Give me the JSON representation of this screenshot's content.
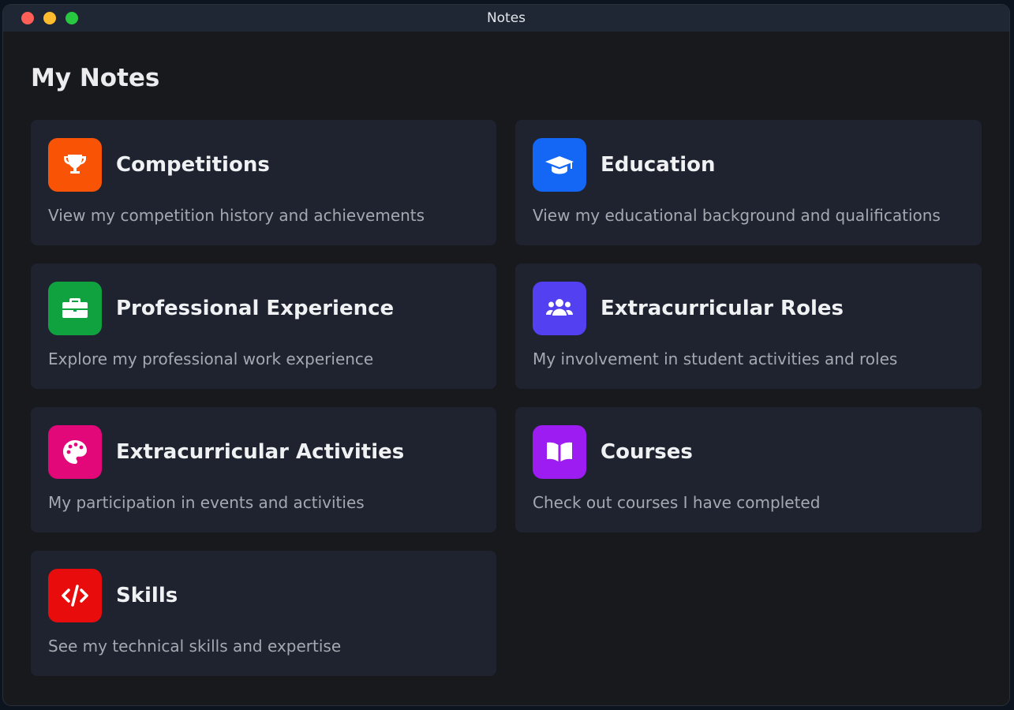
{
  "window": {
    "title": "Notes"
  },
  "page": {
    "title": "My Notes"
  },
  "cards": [
    {
      "title": "Competitions",
      "desc": "View my competition history and achievements",
      "icon": "trophy-icon",
      "color": "#f95406"
    },
    {
      "title": "Education",
      "desc": "View my educational background and qualifications",
      "icon": "graduation-cap-icon",
      "color": "#1466f5"
    },
    {
      "title": "Professional Experience",
      "desc": "Explore my professional work experience",
      "icon": "briefcase-icon",
      "color": "#10a23f"
    },
    {
      "title": "Extracurricular Roles",
      "desc": "My involvement in student activities and roles",
      "icon": "users-icon",
      "color": "#5340f0"
    },
    {
      "title": "Extracurricular Activities",
      "desc": "My participation in events and activities",
      "icon": "palette-icon",
      "color": "#e3087a"
    },
    {
      "title": "Courses",
      "desc": "Check out courses I have completed",
      "icon": "book-icon",
      "color": "#9c1cf2"
    },
    {
      "title": "Skills",
      "desc": "See my technical skills and expertise",
      "icon": "code-icon",
      "color": "#e80c0c"
    }
  ]
}
